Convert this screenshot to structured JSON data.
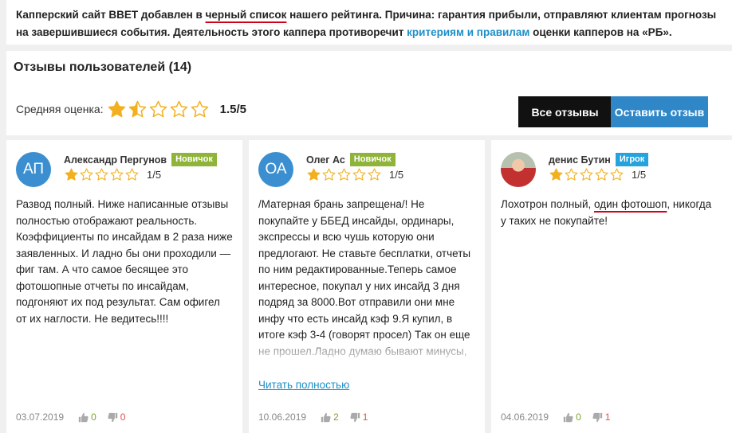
{
  "notice": {
    "p1": "Капперский сайт BBET добавлен в ",
    "highlight": "черный список",
    "p2": " нашего рейтинга. Причина: гарантия прибыли, отправляют клиентам прогнозы на завершившиеся события. Деятельность этого каппера противоречит ",
    "link": "критериям и правилам",
    "p3": " оценки капперов на «РБ».",
    "highlight_color": "#d0021b",
    "link_color": "#1b8fc9"
  },
  "summary": {
    "title": "Отзывы пользователей (14)",
    "avg_label": "Средняя оценка:",
    "avg_rating": 1.5,
    "avg_text": "1.5/5",
    "btn_all": "Все отзывы",
    "btn_leave": "Оставить отзыв",
    "star_color": "#f2b01e"
  },
  "reviews": [
    {
      "initials": "АП",
      "name": "Александр Пергунов",
      "badge": "Новичок",
      "rating": 1,
      "rating_text": "1/5",
      "text": "Развод полный. Ниже написанные отзывы полностью отображают реальность. Коэффициенты по инсайдам в 2 раза ниже заявленных. И ладно бы они проходили — фиг  там. А что самое бесящее это фотошопные отчеты по инсайдам, подгоняют их под результат. Сам офигел от их наглости. Не ведитесь!!!!",
      "date": "03.07.2019",
      "likes": "0",
      "dislikes": "0"
    },
    {
      "initials": "ОА",
      "name": "Олег Ас",
      "badge": "Новичок",
      "rating": 1,
      "rating_text": "1/5",
      "text": "/Матерная брань запрещена/! Не покупайте у ББЕД инсайды, ординары, экспрессы и всю чушь которую они предлогают. Не ставьте бесплатки, отчеты по ним редактированные.Теперь самое интересное, покупал у них инсайд 3 дня подряд за 8000.Вот отправили они мне инфу что есть инсайд кэф 9.Я купил, в итоге кэф 3-4 (говорят просел) Так он еще не прошел.Ладно думаю бывают минусы, затем в группу они выкладывают отчет что",
      "read_more": "Читать полностью",
      "date": "10.06.2019",
      "likes": "2",
      "dislikes": "1"
    },
    {
      "name": "денис Бутин",
      "badge": "Игрок",
      "rating": 1,
      "rating_text": "1/5",
      "text_p1": "Лохотрон полный, ",
      "text_hl": "один фотошоп",
      "text_p2": ", никогда у таких не покупайте!",
      "date": "04.06.2019",
      "likes": "0",
      "dislikes": "1"
    }
  ]
}
